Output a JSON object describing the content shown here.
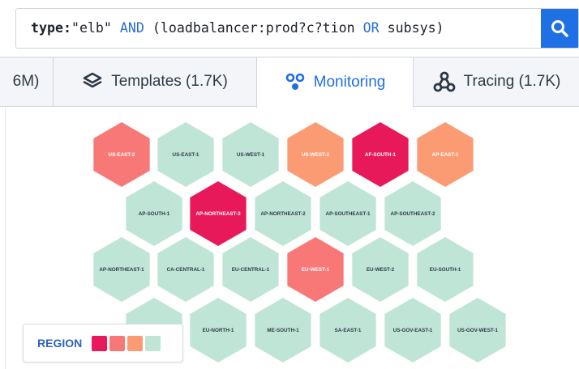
{
  "search": {
    "key": "type:",
    "value": "\"elb\" ",
    "op_and": "AND",
    "group_open": " (loadbalancer:prod?c?tion ",
    "op_or": "OR",
    "group_rest": " subsys)",
    "button_icon": "search-icon"
  },
  "tabs": [
    {
      "label": "6M)",
      "icon": "",
      "active": false
    },
    {
      "label": "Templates (1.7K)",
      "icon": "layers-icon",
      "active": false
    },
    {
      "label": "Monitoring",
      "icon": "monitoring-icon",
      "active": true
    },
    {
      "label": "Tracing (1.7K)",
      "icon": "tracing-icon",
      "active": false
    }
  ],
  "colors": {
    "critical": "#e8195a",
    "high": "#f87878",
    "medium": "#fb9b73",
    "ok": "#bfe5d6",
    "accent": "#1f6fe5"
  },
  "hexes": [
    {
      "label": "US-EAST-2",
      "level": "high"
    },
    {
      "label": "US-EAST-1",
      "level": "ok"
    },
    {
      "label": "US-WEST-1",
      "level": "ok"
    },
    {
      "label": "US-WEST-2",
      "level": "medium"
    },
    {
      "label": "AF-SOUTH-1",
      "level": "critical"
    },
    {
      "label": "AP-EAST-1",
      "level": "medium"
    },
    {
      "label": "AP-SOUTH-1",
      "level": "ok"
    },
    {
      "label": "AP-NORTHEAST-3",
      "level": "critical"
    },
    {
      "label": "AP-NORTHEAST-2",
      "level": "ok"
    },
    {
      "label": "AP-SOUTHEAST-1",
      "level": "ok"
    },
    {
      "label": "AP-SOUTHEAST-2",
      "level": "ok"
    },
    {
      "label": "AP-NORTHEAST-1",
      "level": "ok"
    },
    {
      "label": "CA-CENTRAL-1",
      "level": "ok"
    },
    {
      "label": "EU-CENTRAL-1",
      "level": "ok"
    },
    {
      "label": "EU-WEST-1",
      "level": "high"
    },
    {
      "label": "EU-WEST-2",
      "level": "ok"
    },
    {
      "label": "EU-SOUTH-1",
      "level": "ok"
    },
    {
      "label": "",
      "level": "ok"
    },
    {
      "label": "EU-NORTH-1",
      "level": "ok"
    },
    {
      "label": "ME-SOUTH-1",
      "level": "ok"
    },
    {
      "label": "SA-EAST-1",
      "level": "ok"
    },
    {
      "label": "US-GOV-EAST-1",
      "level": "ok"
    },
    {
      "label": "US-GOV-WEST-1",
      "level": "ok"
    }
  ],
  "legend": {
    "title": "REGION",
    "levels": [
      "critical",
      "high",
      "medium",
      "ok"
    ]
  }
}
